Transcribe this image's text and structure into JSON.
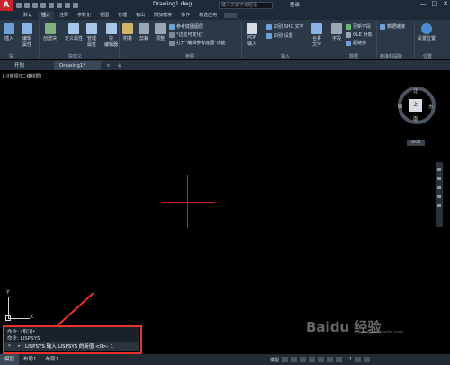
{
  "titlebar": {
    "app_logo": "A",
    "doc_title": "Drawing1.dwg",
    "search_placeholder": "键入关键字或短语",
    "login": "登录",
    "min": "—",
    "max": "□",
    "close": "✕"
  },
  "menu": {
    "tabs": [
      "默认",
      "插入",
      "注释",
      "参数化",
      "视图",
      "管理",
      "输出",
      "附加模块",
      "协作",
      "精选应用"
    ],
    "active_tab": "插入"
  },
  "ribbon": {
    "buttons": {
      "insert": "插入",
      "edit_attr": "编辑\n属性",
      "create": "创建块",
      "define_attr": "定义属性",
      "manage_attr": "管理\n属性",
      "block_editor": "块\n编辑器",
      "attach": "附着",
      "clip": "剪裁",
      "adjust": "调整",
      "pdf": "PDF\n输入",
      "shx": "识别 SHX 文字",
      "recognize": "识别 设置",
      "merge_text": "合并\n文字",
      "field": "字段",
      "update_field": "更新字段",
      "ole": "OLE 对象",
      "hyperlink": "超链接",
      "data_link": "数据链接",
      "set_location": "设置位置",
      "underlay_layers": "参考底图图层",
      "frames": "*边框可变化*",
      "ref_manager": "打开\"编辑参考底图\"功能"
    },
    "panels": [
      "块",
      "块定义",
      "参照",
      "输入",
      "数据",
      "链接和提取",
      "位置"
    ]
  },
  "filetabs": {
    "home": "开始",
    "doc": "Drawing1*",
    "close": "×",
    "add": "+"
  },
  "viewport": {
    "control": "[-][俯视][二维线框]"
  },
  "viewcube": {
    "north": "北",
    "south": "南",
    "east": "东",
    "west": "西",
    "top": "上",
    "wcs": "WCS"
  },
  "ucs": {
    "x": "X",
    "y": "Y"
  },
  "command": {
    "history": [
      "命令: *取消*",
      "命令: LISPSYS"
    ],
    "prompt": "LISPSYS 输入 LISPSYS 的新值 <0>: 1"
  },
  "statusbar": {
    "tabs": [
      "模型",
      "布局1",
      "布局2"
    ],
    "active_tab": "模型",
    "model_label": "模型",
    "scale": "1:1"
  },
  "watermark": {
    "main": "Baidu 经验",
    "sub": "jingyan.baidu.com"
  },
  "colors": {
    "crosshair": "#c81e1e",
    "highlight": "#e8312a",
    "app_red": "#c8242b"
  }
}
